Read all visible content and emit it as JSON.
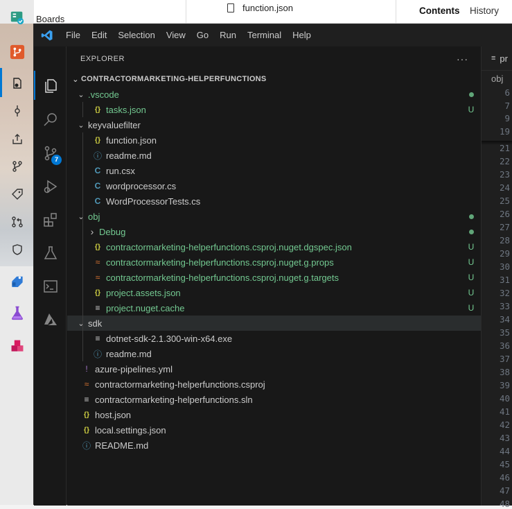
{
  "background": {
    "boards_label": "Boards",
    "file_tab": "function.json",
    "contents_tab": "Contents",
    "history_tab": "History"
  },
  "menu": [
    "File",
    "Edit",
    "Selection",
    "View",
    "Go",
    "Run",
    "Terminal",
    "Help"
  ],
  "activity": {
    "scm_badge": "7"
  },
  "explorer": {
    "title": "EXPLORER",
    "more": "···",
    "root": "CONTRACTORMARKETING-HELPERFUNCTIONS",
    "rows": [
      {
        "label": ".vscode",
        "type": "folder",
        "depth": 1,
        "open": true,
        "status": "dot",
        "color": "#73c991"
      },
      {
        "label": "tasks.json",
        "type": "json",
        "depth": 2,
        "status": "U",
        "color": "#73c991"
      },
      {
        "label": "keyvaluefilter",
        "type": "folder",
        "depth": 1,
        "open": true
      },
      {
        "label": "function.json",
        "type": "json",
        "depth": 2
      },
      {
        "label": "readme.md",
        "type": "info",
        "depth": 2
      },
      {
        "label": "run.csx",
        "type": "csharp",
        "depth": 2
      },
      {
        "label": "wordprocessor.cs",
        "type": "csharp",
        "depth": 2
      },
      {
        "label": "WordProcessorTests.cs",
        "type": "csharp",
        "depth": 2
      },
      {
        "label": "obj",
        "type": "folder",
        "depth": 1,
        "open": true,
        "status": "dot",
        "color": "#73c991"
      },
      {
        "label": "Debug",
        "type": "folder",
        "depth": 2,
        "open": false,
        "status": "dot",
        "color": "#73c991"
      },
      {
        "label": "contractormarketing-helperfunctions.csproj.nuget.dgspec.json",
        "type": "json",
        "depth": 2,
        "status": "U",
        "color": "#73c991"
      },
      {
        "label": "contractormarketing-helperfunctions.csproj.nuget.g.props",
        "type": "rss",
        "depth": 2,
        "status": "U",
        "color": "#73c991"
      },
      {
        "label": "contractormarketing-helperfunctions.csproj.nuget.g.targets",
        "type": "rss",
        "depth": 2,
        "status": "U",
        "color": "#73c991"
      },
      {
        "label": "project.assets.json",
        "type": "json",
        "depth": 2,
        "status": "U",
        "color": "#73c991"
      },
      {
        "label": "project.nuget.cache",
        "type": "lines",
        "depth": 2,
        "status": "U",
        "color": "#73c991"
      },
      {
        "label": "sdk",
        "type": "folder",
        "depth": 1,
        "open": true,
        "selected": true
      },
      {
        "label": "dotnet-sdk-2.1.300-win-x64.exe",
        "type": "lines",
        "depth": 2
      },
      {
        "label": "readme.md",
        "type": "info",
        "depth": 2
      },
      {
        "label": "azure-pipelines.yml",
        "type": "yml",
        "depth": 1
      },
      {
        "label": "contractormarketing-helperfunctions.csproj",
        "type": "rss",
        "depth": 1
      },
      {
        "label": "contractormarketing-helperfunctions.sln",
        "type": "lines",
        "depth": 1
      },
      {
        "label": "host.json",
        "type": "json",
        "depth": 1
      },
      {
        "label": "local.settings.json",
        "type": "json",
        "depth": 1
      },
      {
        "label": "README.md",
        "type": "info",
        "depth": 1
      }
    ]
  },
  "editor": {
    "tab_label": "pr",
    "breadcrumb": "obj",
    "sticky_lines": [
      "6",
      "7",
      "9",
      "19"
    ],
    "lines": [
      "21",
      "22",
      "23",
      "24",
      "25",
      "26",
      "27",
      "28",
      "29",
      "30",
      "31",
      "32",
      "33",
      "34",
      "35",
      "36",
      "37",
      "38",
      "39",
      "40",
      "41",
      "42",
      "43",
      "44",
      "45",
      "46",
      "47",
      "48"
    ]
  }
}
